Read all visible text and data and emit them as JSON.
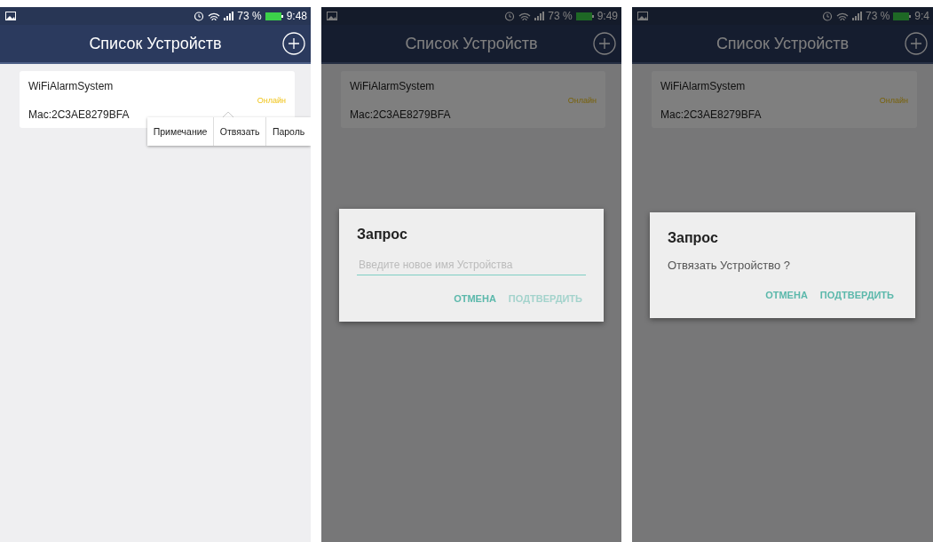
{
  "screens": [
    {
      "dimmed": false,
      "status_bar": {
        "battery": "73 %",
        "time": "9:48"
      },
      "header": {
        "title": "Список Устройств"
      },
      "devices": [
        {
          "name": "WiFiAlarmSystem",
          "mac": "Mac:2C3AE8279BFA",
          "status": "Онлайн"
        }
      ],
      "popup_menu": [
        "Примечание",
        "Отвязать",
        "Пароль"
      ]
    },
    {
      "dimmed": true,
      "status_bar": {
        "battery": "73 %",
        "time": "9:49"
      },
      "header": {
        "title": "Список Устройств"
      },
      "devices": [
        {
          "name": "WiFiAlarmSystem",
          "mac": "Mac:2C3AE8279BFA",
          "status": "Онлайн"
        }
      ],
      "dialog": {
        "kind": "input",
        "title": "Запрос",
        "placeholder": "Введите новое имя Устройства",
        "buttons": [
          {
            "label": "ОТМЕНА",
            "disabled": false
          },
          {
            "label": "ПОДТВЕРДИТЬ",
            "disabled": true
          }
        ]
      }
    },
    {
      "dimmed": true,
      "status_bar": {
        "battery": "73 %",
        "time": "9:4"
      },
      "header": {
        "title": "Список Устройств"
      },
      "devices": [
        {
          "name": "WiFiAlarmSystem",
          "mac": "Mac:2C3AE8279BFA",
          "status": "Онлайн"
        }
      ],
      "dialog": {
        "kind": "message",
        "title": "Запрос",
        "message": "Отвязать Устройство ?",
        "buttons": [
          {
            "label": "ОТМЕНА",
            "disabled": false
          },
          {
            "label": "ПОДТВЕРДИТЬ",
            "disabled": false
          }
        ]
      }
    }
  ]
}
